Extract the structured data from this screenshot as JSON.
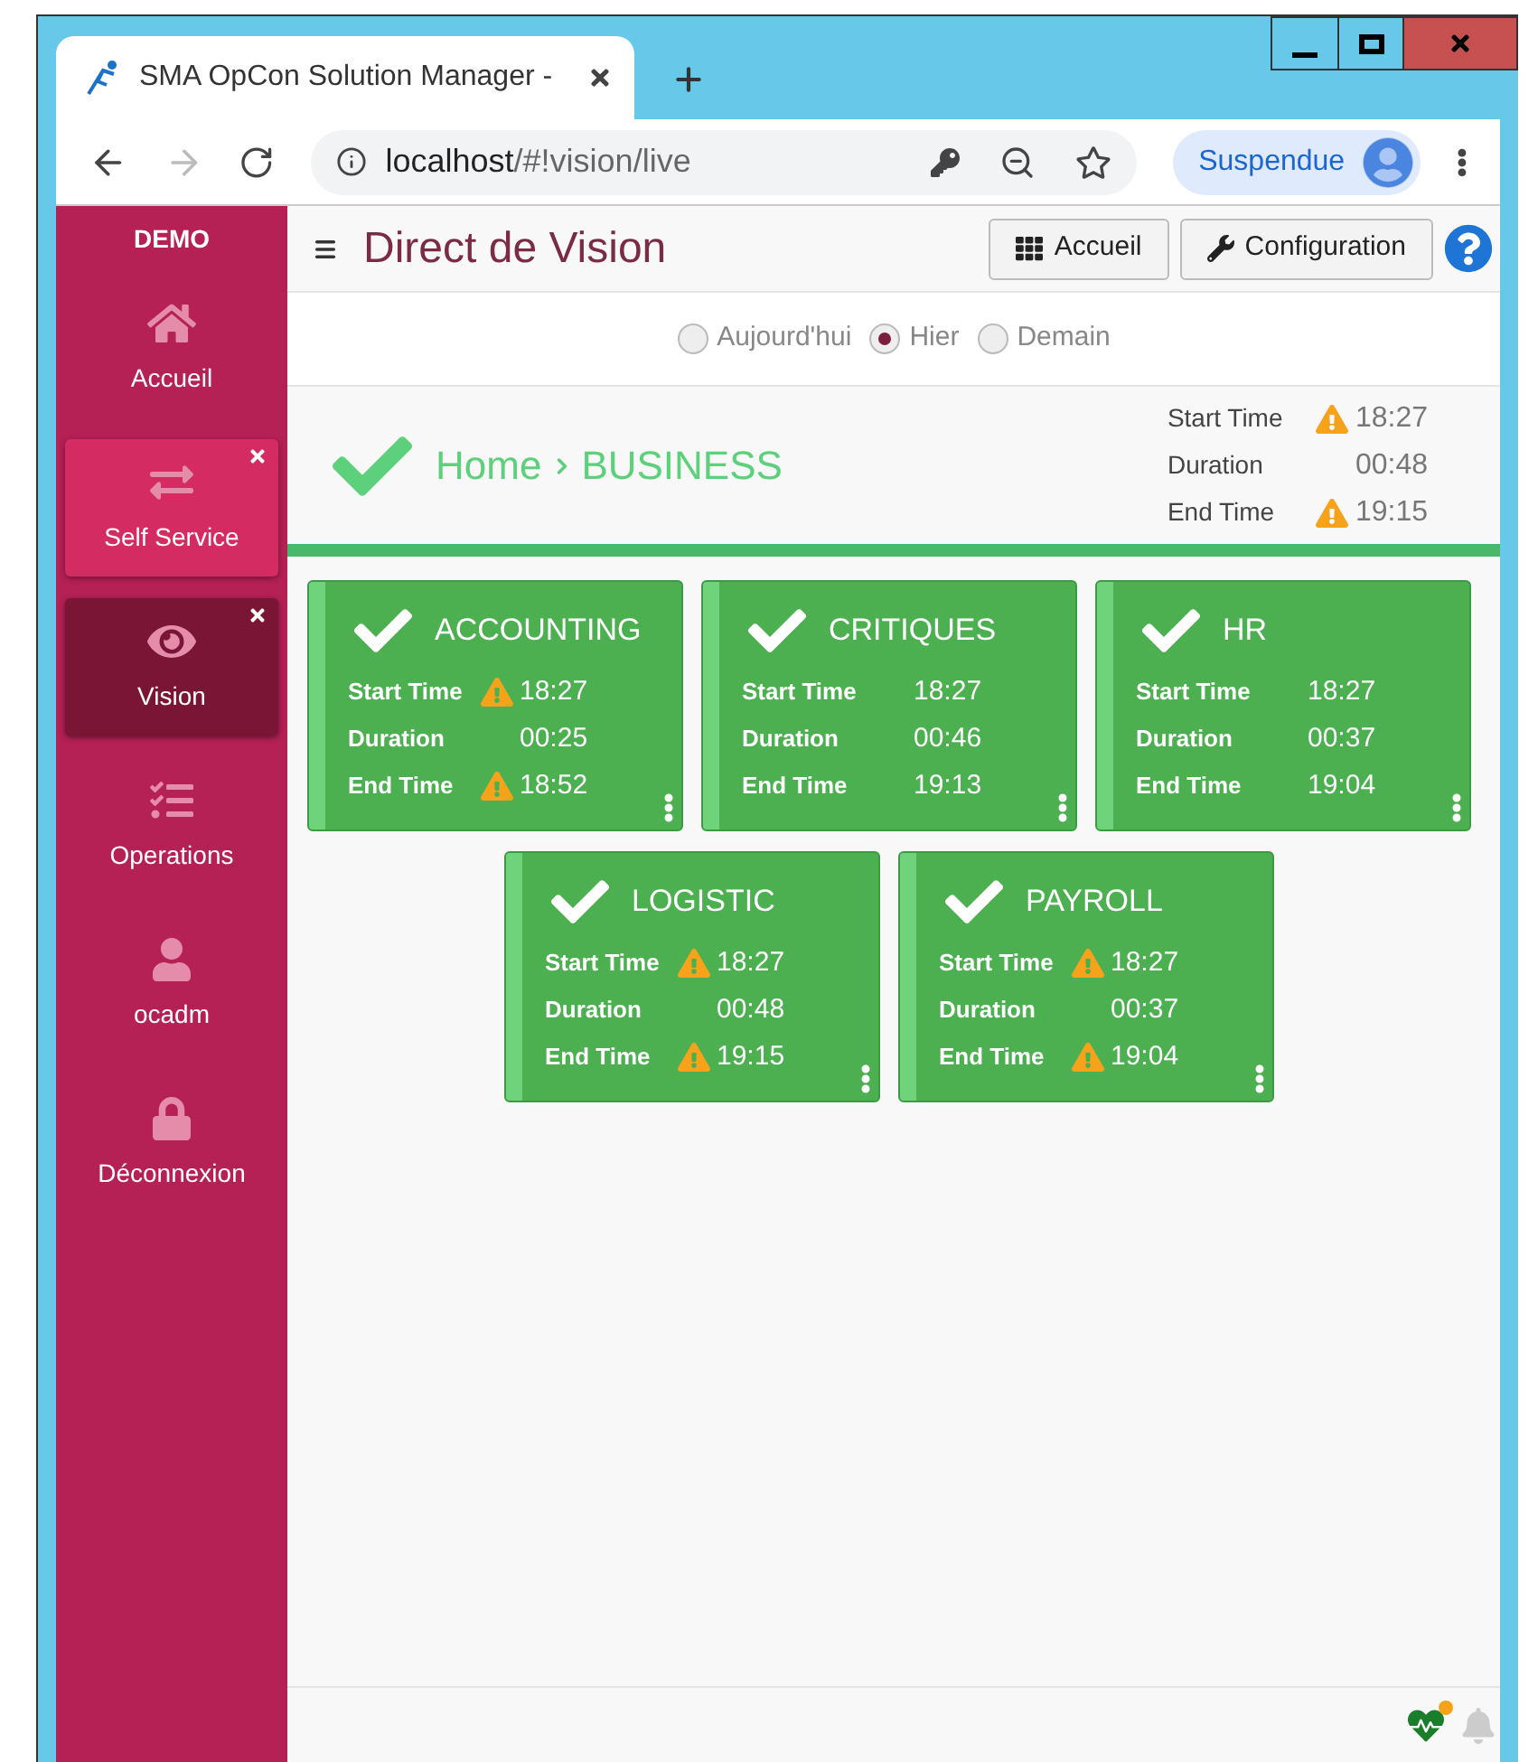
{
  "browser": {
    "tab_title": "SMA OpCon Solution Manager -",
    "url_host": "localhost",
    "url_path": "/#!vision/live",
    "profile": "Suspendue"
  },
  "sidebar": {
    "environment": "DEMO",
    "items": [
      {
        "label": "Accueil",
        "open": false,
        "selected": false
      },
      {
        "label": "Self Service",
        "open": true,
        "selected": false
      },
      {
        "label": "Vision",
        "open": true,
        "selected": true
      },
      {
        "label": "Operations",
        "open": false,
        "selected": false
      },
      {
        "label": "ocadm",
        "open": false,
        "selected": false
      },
      {
        "label": "Déconnexion",
        "open": false,
        "selected": false
      }
    ]
  },
  "header": {
    "title": "Direct de Vision",
    "buttons": [
      {
        "label": "Accueil"
      },
      {
        "label": "Configuration"
      }
    ]
  },
  "day_options": [
    {
      "label": "Aujourd'hui",
      "selected": false
    },
    {
      "label": "Hier",
      "selected": true
    },
    {
      "label": "Demain",
      "selected": false
    }
  ],
  "breadcrumb": [
    "Home",
    "BUSINESS"
  ],
  "summary": [
    {
      "label": "Start Time",
      "warning": true,
      "value": "18:27"
    },
    {
      "label": "Duration",
      "warning": false,
      "value": "00:48"
    },
    {
      "label": "End Time",
      "warning": true,
      "value": "19:15"
    }
  ],
  "tiles": [
    {
      "name": "ACCOUNTING",
      "rows": [
        {
          "label": "Start Time",
          "warning": true,
          "value": "18:27"
        },
        {
          "label": "Duration",
          "warning": false,
          "value": "00:25"
        },
        {
          "label": "End Time",
          "warning": true,
          "value": "18:52"
        }
      ]
    },
    {
      "name": "CRITIQUES",
      "rows": [
        {
          "label": "Start Time",
          "warning": false,
          "value": "18:27"
        },
        {
          "label": "Duration",
          "warning": false,
          "value": "00:46"
        },
        {
          "label": "End Time",
          "warning": false,
          "value": "19:13"
        }
      ]
    },
    {
      "name": "HR",
      "rows": [
        {
          "label": "Start Time",
          "warning": false,
          "value": "18:27"
        },
        {
          "label": "Duration",
          "warning": false,
          "value": "00:37"
        },
        {
          "label": "End Time",
          "warning": false,
          "value": "19:04"
        }
      ]
    },
    {
      "name": "LOGISTIC",
      "rows": [
        {
          "label": "Start Time",
          "warning": true,
          "value": "18:27"
        },
        {
          "label": "Duration",
          "warning": false,
          "value": "00:48"
        },
        {
          "label": "End Time",
          "warning": true,
          "value": "19:15"
        }
      ]
    },
    {
      "name": "PAYROLL",
      "rows": [
        {
          "label": "Start Time",
          "warning": true,
          "value": "18:27"
        },
        {
          "label": "Duration",
          "warning": false,
          "value": "00:37"
        },
        {
          "label": "End Time",
          "warning": true,
          "value": "19:04"
        }
      ]
    }
  ],
  "status": {
    "health_alert": true
  }
}
